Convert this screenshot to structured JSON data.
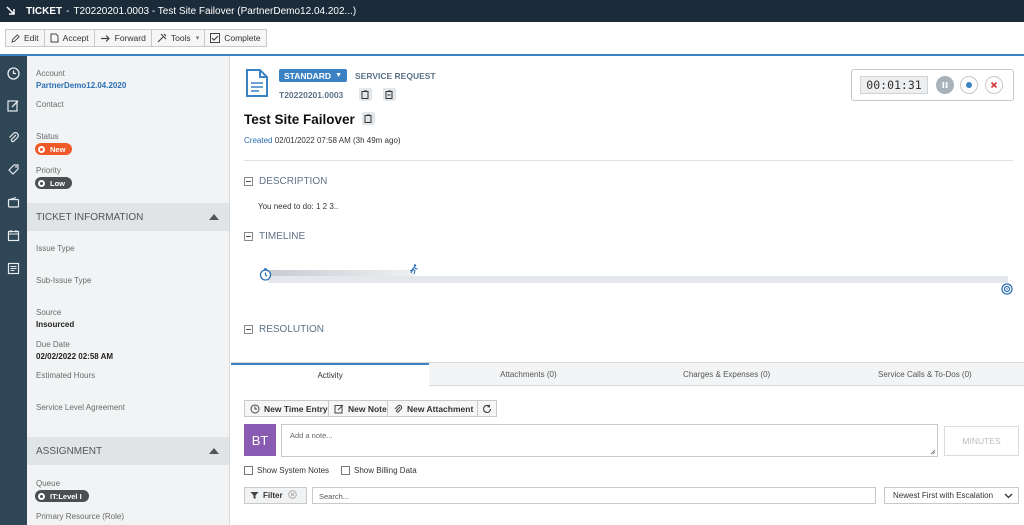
{
  "window": {
    "module": "TICKET",
    "separator": "-",
    "title": "T20220201.0003 - Test Site Failover (PartnerDemo12.04.202...)"
  },
  "toolbar": {
    "edit": "Edit",
    "accept": "Accept",
    "forward": "Forward",
    "tools": "Tools",
    "complete": "Complete"
  },
  "left": {
    "account_label": "Account",
    "account_value": "PartnerDemo12.04.2020",
    "contact_label": "Contact",
    "status_label": "Status",
    "status_value": "New",
    "priority_label": "Priority",
    "priority_value": "Low",
    "ticket_info_header": "TICKET INFORMATION",
    "issue_type_label": "Issue Type",
    "sub_issue_type_label": "Sub-Issue Type",
    "source_label": "Source",
    "source_value": "Insourced",
    "due_date_label": "Due Date",
    "due_date_value": "02/02/2022 02:58 AM",
    "estimated_hours_label": "Estimated Hours",
    "sla_label": "Service Level Agreement",
    "assignment_header": "ASSIGNMENT",
    "queue_label": "Queue",
    "queue_value": "IT:Level I",
    "primary_resource_label": "Primary Resource (Role)"
  },
  "ticket": {
    "type_badge": "STANDARD",
    "category": "SERVICE REQUEST",
    "number": "T20220201.0003",
    "title": "Test Site Failover",
    "created_label": "Created",
    "created_value": "02/01/2022 07:58 AM (3h 49m ago)"
  },
  "timer": {
    "value": "00:01:31"
  },
  "sections": {
    "description": "DESCRIPTION",
    "description_text": "You need to do: 1 2 3..",
    "timeline": "TIMELINE",
    "resolution": "RESOLUTION"
  },
  "tabs": [
    "Activity",
    "Attachments (0)",
    "Charges & Expenses (0)",
    "Service Calls & To-Dos (0)"
  ],
  "activity": {
    "new_time_entry": "New Time Entry",
    "new_note": "New Note",
    "new_attachment": "New Attachment",
    "avatar_initials": "BT",
    "note_placeholder": "Add a note...",
    "minutes_placeholder": "MINUTES",
    "show_system_notes": "Show System Notes",
    "show_billing_data": "Show Billing Data",
    "filter": "Filter",
    "search_placeholder": "Search...",
    "sort": "Newest First with Escalation"
  },
  "colors": {
    "accent": "#3b82c4",
    "status_new": "#f05a28",
    "dark": "#1c2b39",
    "rail": "#2f4656",
    "avatar": "#8a5bb3"
  }
}
